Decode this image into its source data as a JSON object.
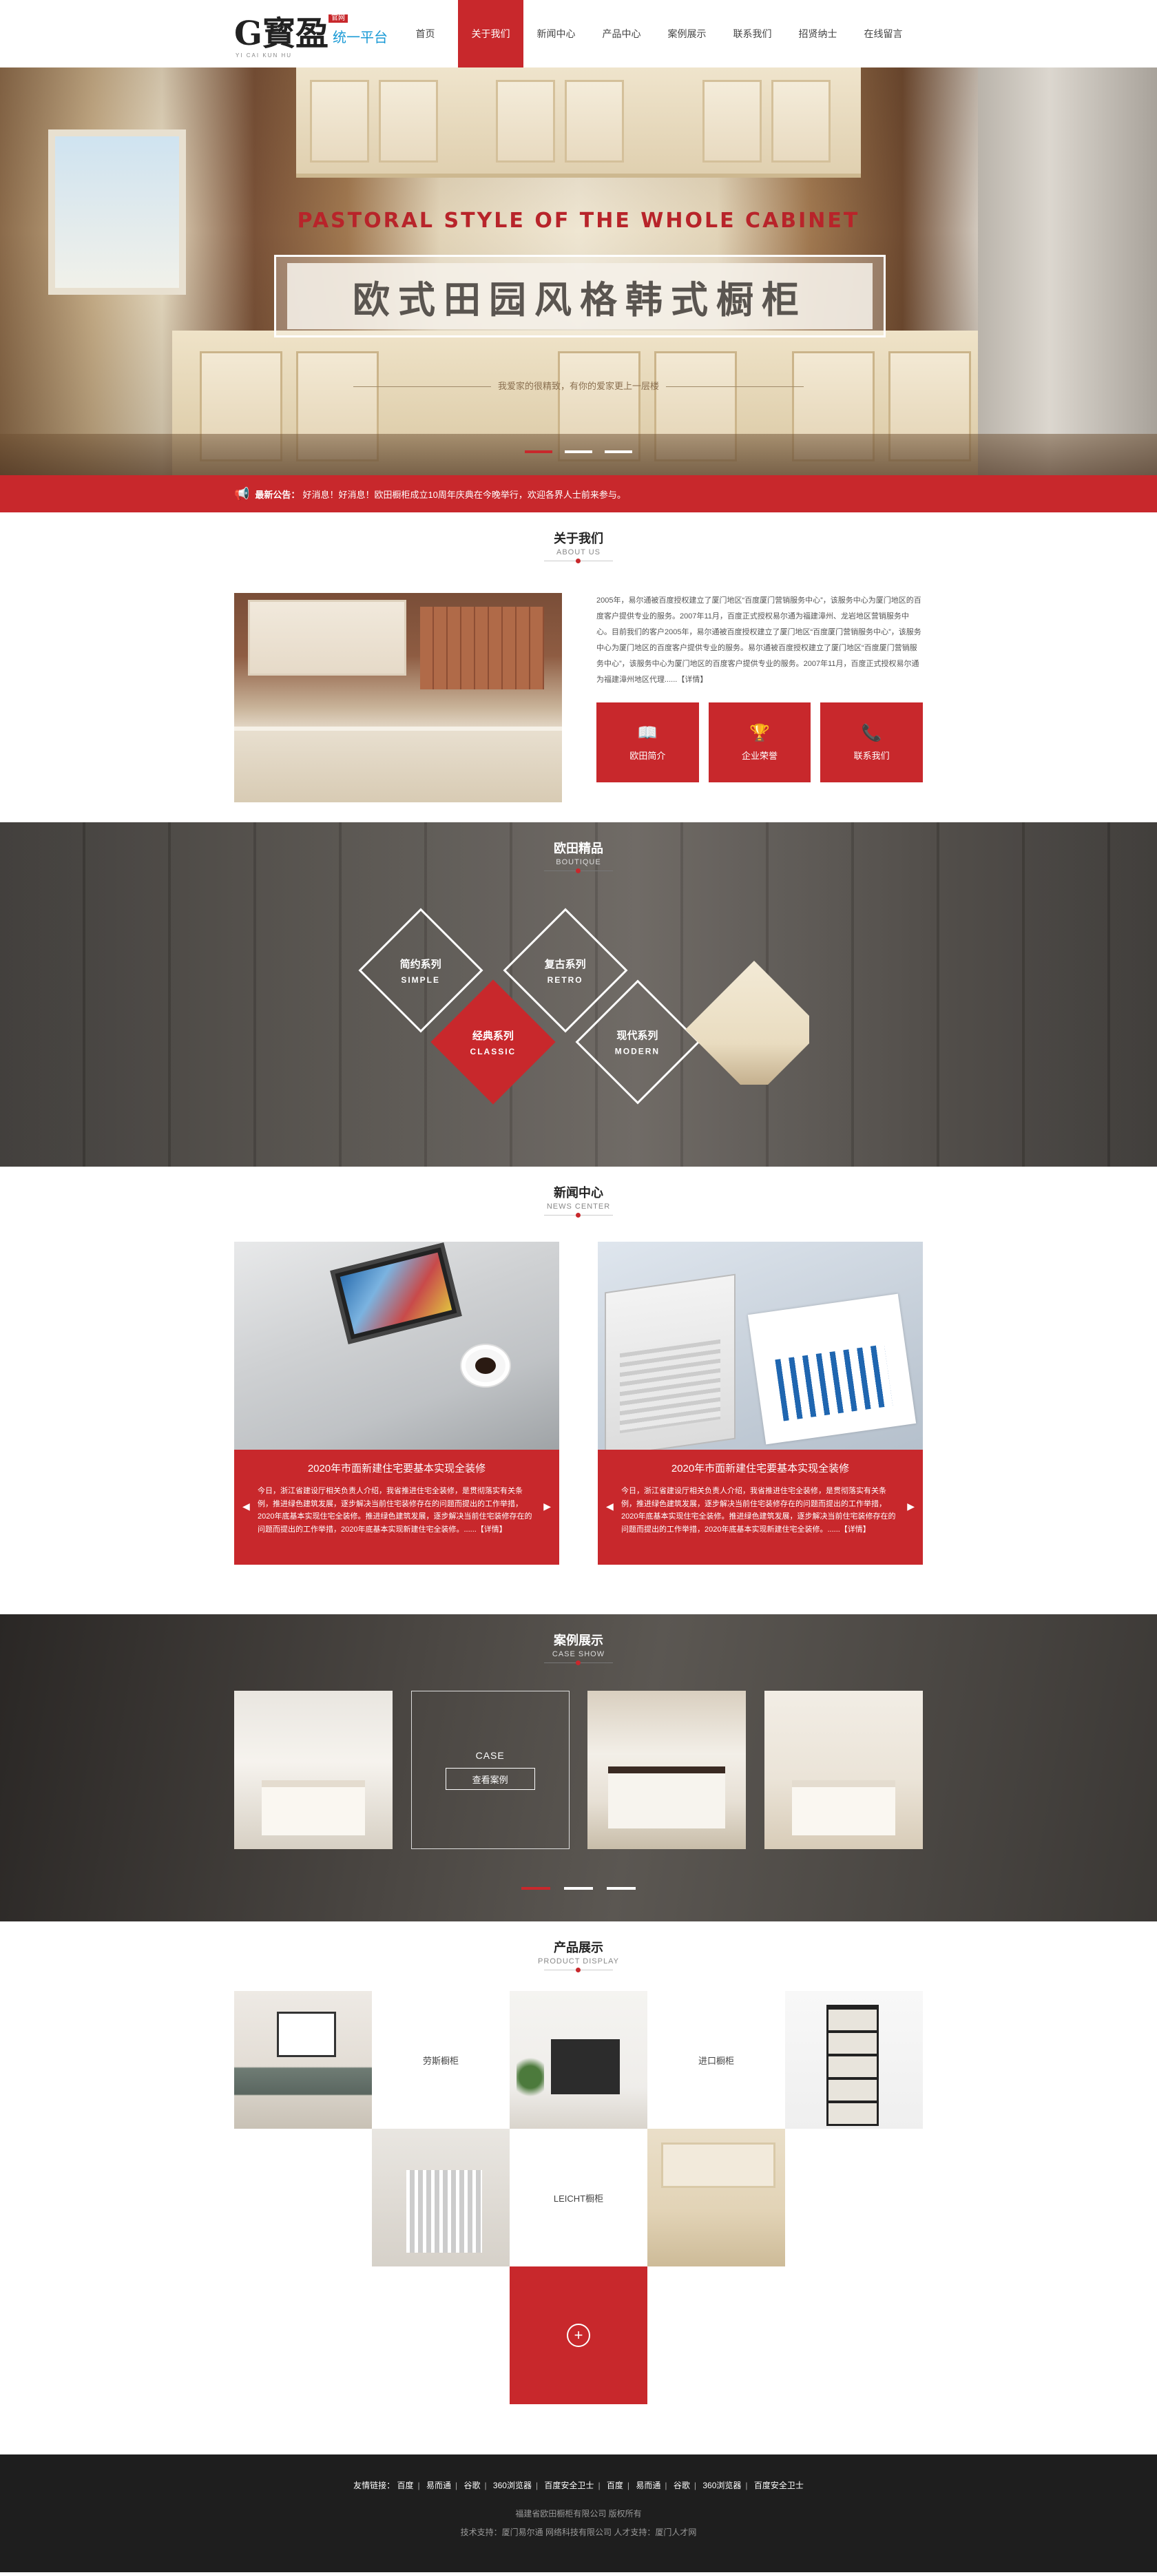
{
  "header": {
    "logo_mark": "G寳盈",
    "logo_badge": "官网",
    "logo_sub": "YI CAI KUN HU",
    "logo_text": "统一平台",
    "nav": [
      "首页",
      "关于我们",
      "新闻中心",
      "产品中心",
      "案例展示",
      "联系我们",
      "招贤纳士",
      "在线留言"
    ],
    "nav_active": 1
  },
  "banner": {
    "en_title": "PASTORAL STYLE OF THE WHOLE CABINET",
    "title": "欧式田园风格韩式橱柜",
    "subtitle": "我爱家的很精致，有你的爱家更上一层楼"
  },
  "notice": {
    "label": "最新公告：",
    "text": "好消息！好消息！欧田橱柜成立10周年庆典在今晚举行，欢迎各界人士前来参与。"
  },
  "about": {
    "title": "关于我们",
    "en": "ABOUT US",
    "text": "2005年，易尔通被百度授权建立了厦门地区“百度厦门营销服务中心”，该服务中心为厦门地区的百度客户提供专业的服务。2007年11月，百度正式授权易尔通为福建漳州、龙岩地区营销服务中心。目前我们的客户2005年，易尔通被百度授权建立了厦门地区“百度厦门营销服务中心”，该服务中心为厦门地区的百度客户提供专业的服务。易尔通被百度授权建立了厦门地区“百度厦门营销服务中心”，该服务中心为厦门地区的百度客户提供专业的服务。2007年11月，百度正式授权易尔通为福建漳州地区代理......【详情】",
    "buttons": [
      {
        "icon": "book",
        "label": "欧田简介"
      },
      {
        "icon": "trophy",
        "label": "企业荣誉"
      },
      {
        "icon": "phone",
        "label": "联系我们"
      }
    ]
  },
  "boutique": {
    "title": "欧田精品",
    "en": "BOUTIQUE",
    "series": [
      {
        "cn": "简约系列",
        "en": "SIMPLE"
      },
      {
        "cn": "复古系列",
        "en": "RETRO"
      },
      {
        "cn": "经典系列",
        "en": "CLASSIC"
      },
      {
        "cn": "现代系列",
        "en": "MODERN"
      }
    ]
  },
  "news": {
    "title": "新闻中心",
    "en": "NEWS CENTER",
    "items": [
      {
        "title": "2020年市面新建住宅要基本实现全装修",
        "summary": "今日，浙江省建设厅相关负责人介绍，我省推进住宅全装修，是贯彻落实有关条例，推进绿色建筑发展，逐步解决当前住宅装修存在的问题而提出的工作举措，2020年底基本实现住宅全装修。推进绿色建筑发展，逐步解决当前住宅装修存在的问题而提出的工作举措，2020年底基本实现新建住宅全装修。......【详情】"
      },
      {
        "title": "2020年市面新建住宅要基本实现全装修",
        "summary": "今日，浙江省建设厅相关负责人介绍，我省推进住宅全装修，是贯彻落实有关条例，推进绿色建筑发展，逐步解决当前住宅装修存在的问题而提出的工作举措，2020年底基本实现住宅全装修。推进绿色建筑发展，逐步解决当前住宅装修存在的问题而提出的工作举措，2020年底基本实现新建住宅全装修。......【详情】"
      }
    ]
  },
  "cases": {
    "title": "案例展示",
    "en": "CASE SHOW",
    "case_label": "CASE",
    "view_button": "查看案例"
  },
  "products": {
    "title": "产品展示",
    "en": "PRODUCT DISPLAY",
    "labels": [
      "劳斯橱柜",
      "进口橱柜",
      "LEICHT橱柜"
    ]
  },
  "footer": {
    "links_label": "友情链接：",
    "links": [
      "百度",
      "易而通",
      "谷歌",
      "360浏览器",
      "百度安全卫士",
      "百度",
      "易而通",
      "谷歌",
      "360浏览器",
      "百度安全卫士"
    ],
    "copyright": "福建省欧田橱柜有限公司 版权所有",
    "support": "技术支持：厦门易尔通 网络科技有限公司  人才支持：厦门人才网"
  },
  "colors": {
    "accent": "#c8282c",
    "footer_bg": "#1e1e1e"
  }
}
